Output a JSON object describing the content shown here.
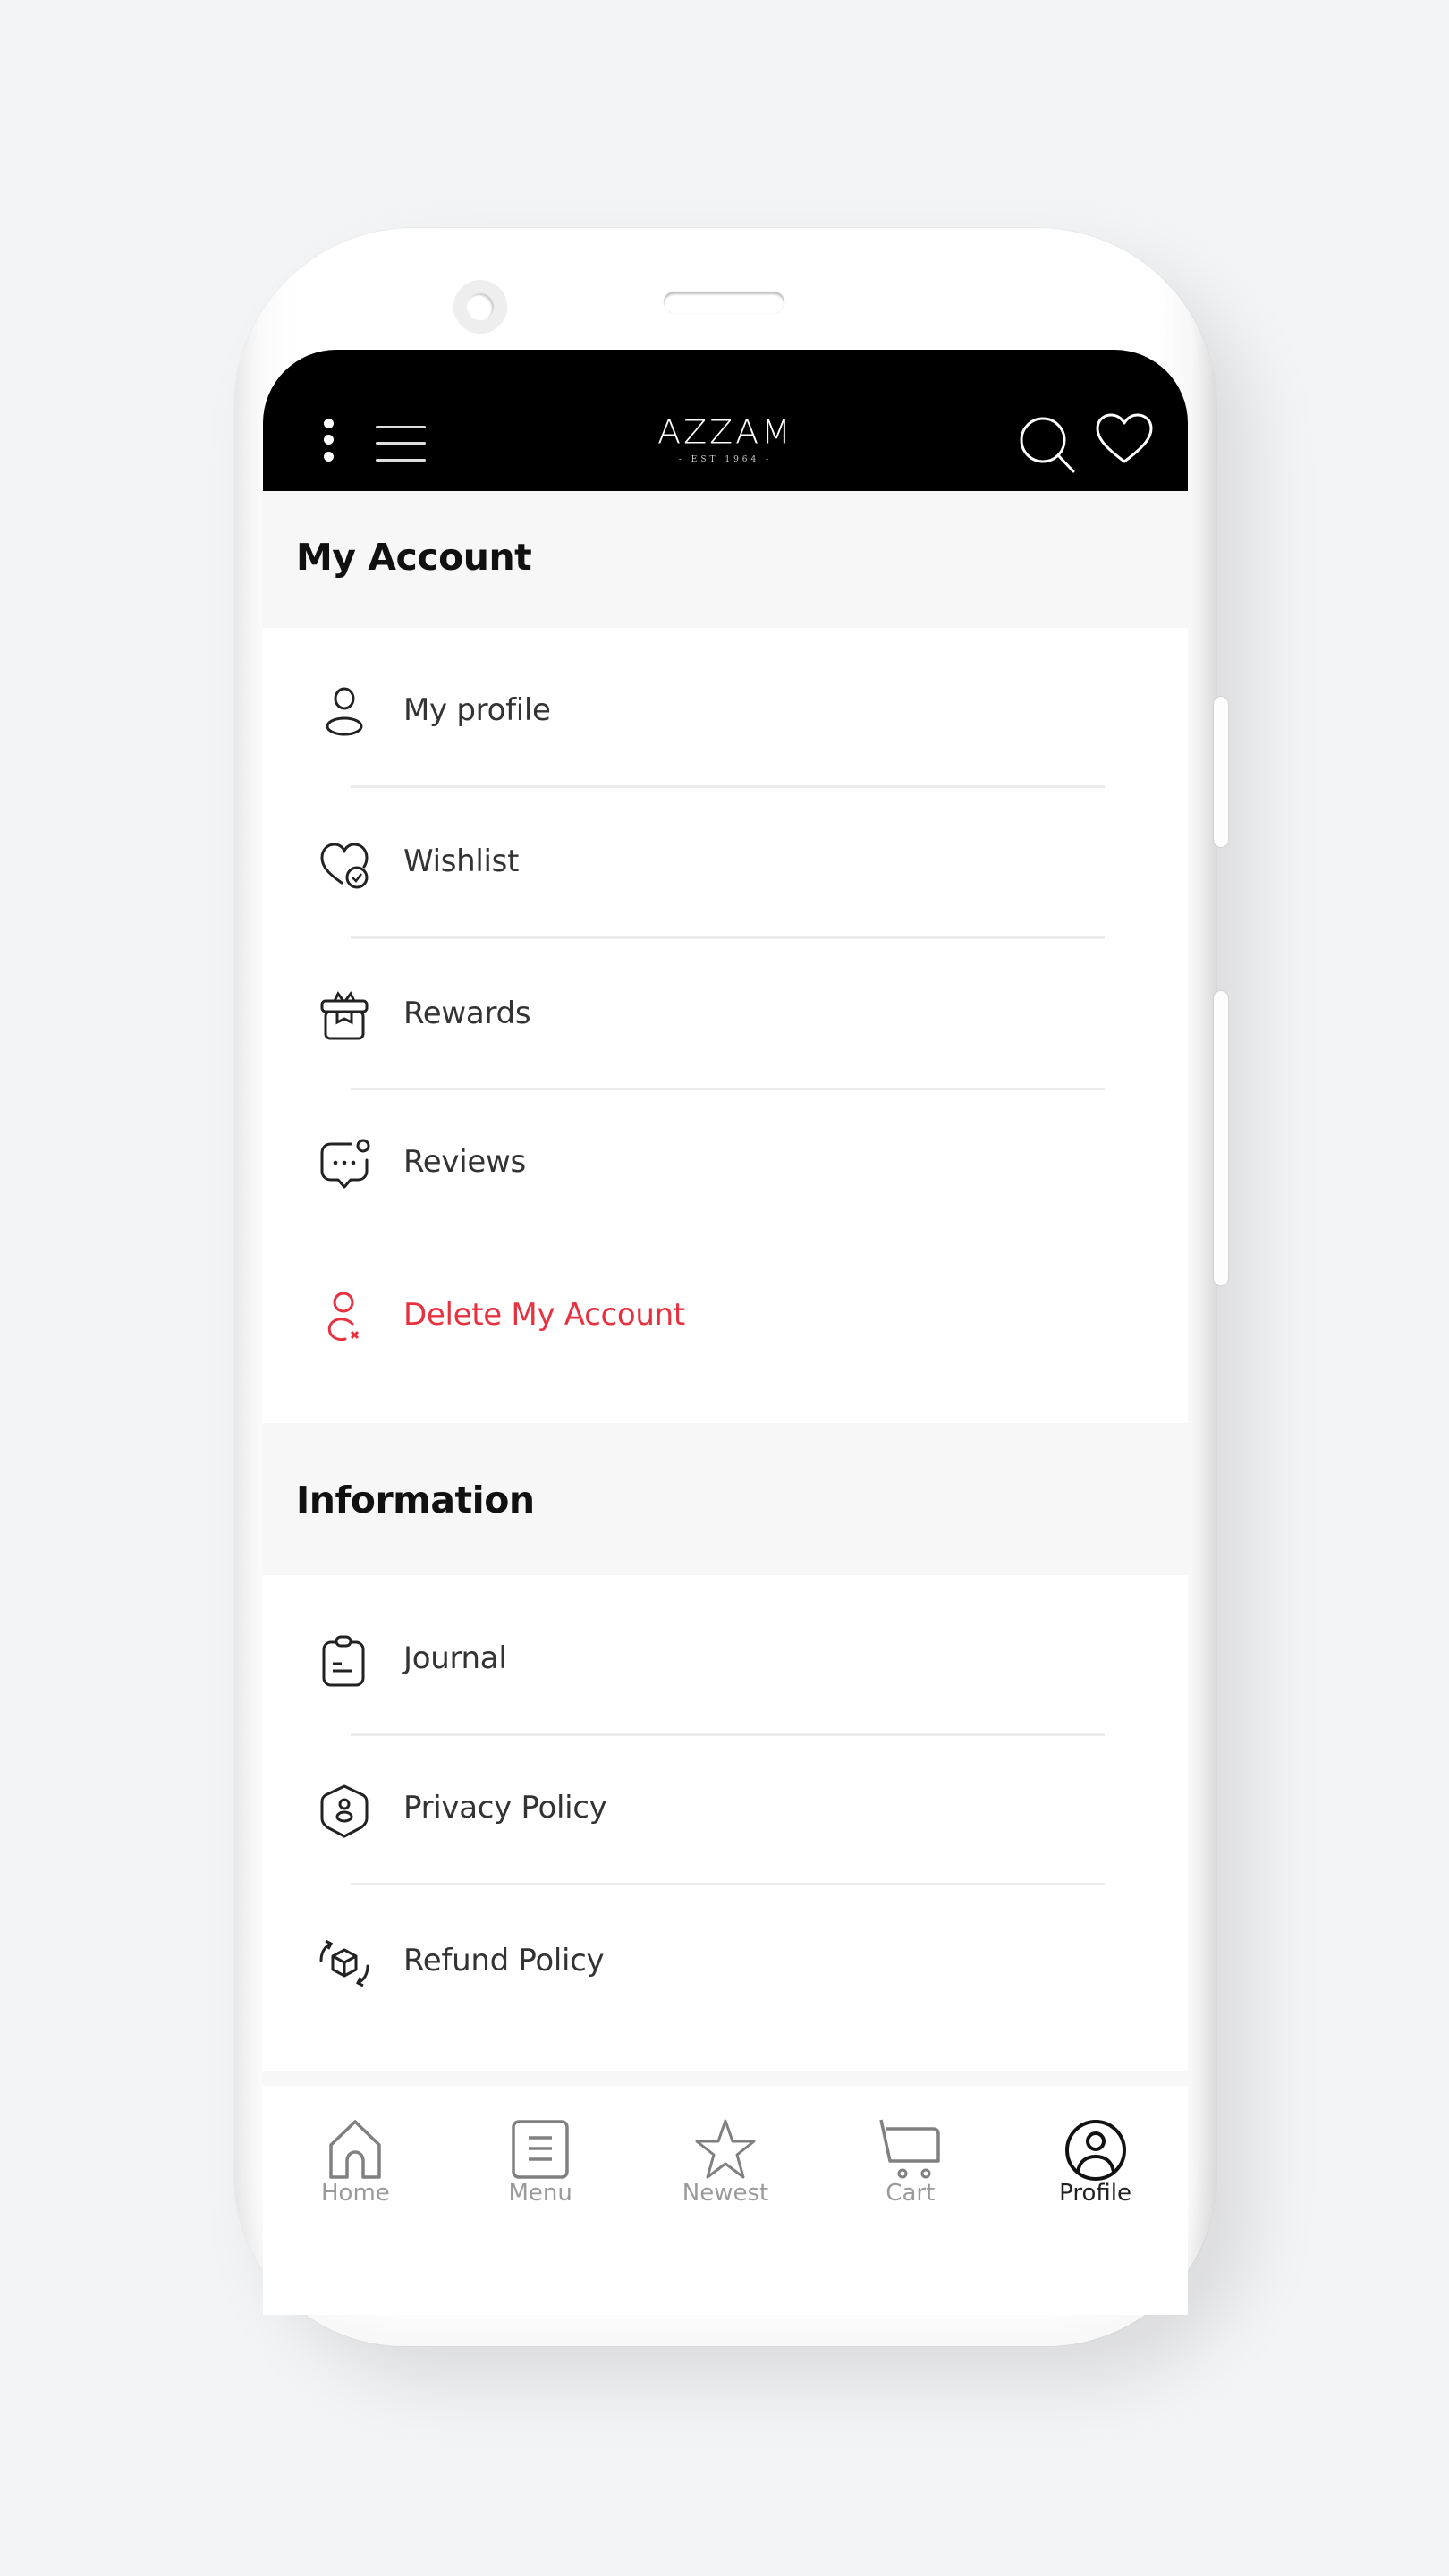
{
  "header": {
    "brand_name": "AZZAM",
    "brand_tagline": "- EST 1964 -",
    "icons": [
      "more-vertical-icon",
      "hamburger-menu-icon",
      "search-icon",
      "heart-icon"
    ]
  },
  "account_section": {
    "title": "My Account",
    "items": [
      {
        "label": "My profile",
        "icon": "user-icon"
      },
      {
        "label": "Wishlist",
        "icon": "heart-check-icon"
      },
      {
        "label": "Rewards",
        "icon": "gift-icon"
      },
      {
        "label": "Reviews",
        "icon": "chat-bubble-icon"
      },
      {
        "label": "Delete My Account",
        "icon": "user-remove-icon",
        "color": "#e8313f"
      }
    ]
  },
  "information_section": {
    "title": "Information",
    "items": [
      {
        "label": "Journal",
        "icon": "clipboard-icon"
      },
      {
        "label": "Privacy Policy",
        "icon": "shield-user-icon"
      },
      {
        "label": "Refund Policy",
        "icon": "box-refresh-icon"
      }
    ]
  },
  "bottom_nav": {
    "items": [
      {
        "label": "Home",
        "icon": "home-icon",
        "active": false
      },
      {
        "label": "Menu",
        "icon": "document-list-icon",
        "active": false
      },
      {
        "label": "Newest",
        "icon": "star-icon",
        "active": false
      },
      {
        "label": "Cart",
        "icon": "cart-icon",
        "active": false
      },
      {
        "label": "Profile",
        "icon": "profile-circle-icon",
        "active": true
      }
    ]
  },
  "colors": {
    "header_bg": "#000000",
    "section_bg": "#f7f7f7",
    "danger": "#e8313f",
    "nav_inactive": "#9a9a9a",
    "nav_active": "#222222",
    "page_bg": "#f3f4f6"
  }
}
